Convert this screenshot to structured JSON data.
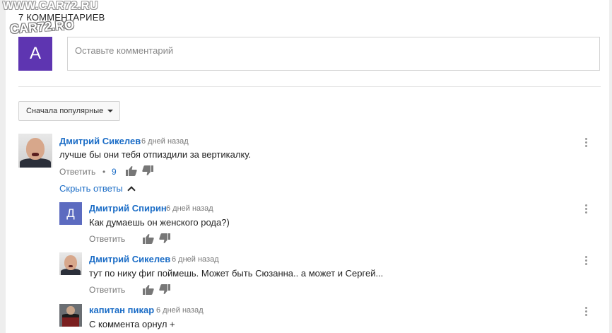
{
  "watermark": {
    "line1": "WWW.CAR72.RU",
    "line2": "CAR72.RO"
  },
  "comments_header": {
    "count_label": "7 КОММЕНТАРИЕВ"
  },
  "composer": {
    "avatar_letter": "А",
    "placeholder": "Оставьте комментарий"
  },
  "sort": {
    "label": "Сначала популярные"
  },
  "thread": {
    "top": {
      "author": "Дмитрий Сикелев",
      "time": "6 дней назад",
      "text": "лучше бы они тебя отпиздили за вертикалку.",
      "reply_label": "Ответить",
      "separator": "•",
      "likes": "9"
    },
    "hide_replies_label": "Скрыть ответы",
    "replies": [
      {
        "author": "Дмитрий Спирин",
        "avatar_letter": "Д",
        "time": "6 дней назад",
        "text": "Как думаешь он женского рода?)",
        "reply_label": "Ответить"
      },
      {
        "author": "Дмитрий Сикелев",
        "time": "6 дней назад",
        "text": "тут по нику фиг поймешь. Может быть Сюзанна.. а может  и Сергей...",
        "reply_label": "Ответить"
      },
      {
        "author": "капитан пикар",
        "time": "6 дней назад",
        "text": "С коммента орнул +"
      }
    ]
  },
  "icons": {
    "like": "thumbs-up-icon",
    "dislike": "thumbs-down-icon",
    "more": "more-vert-icon",
    "expand": "chevron-up-icon",
    "dropdown": "caret-down-icon"
  },
  "colors": {
    "link": "#1a6cc6",
    "composer_avatar": "#5e35b1",
    "reply_avatar": "#5c6bc0"
  }
}
